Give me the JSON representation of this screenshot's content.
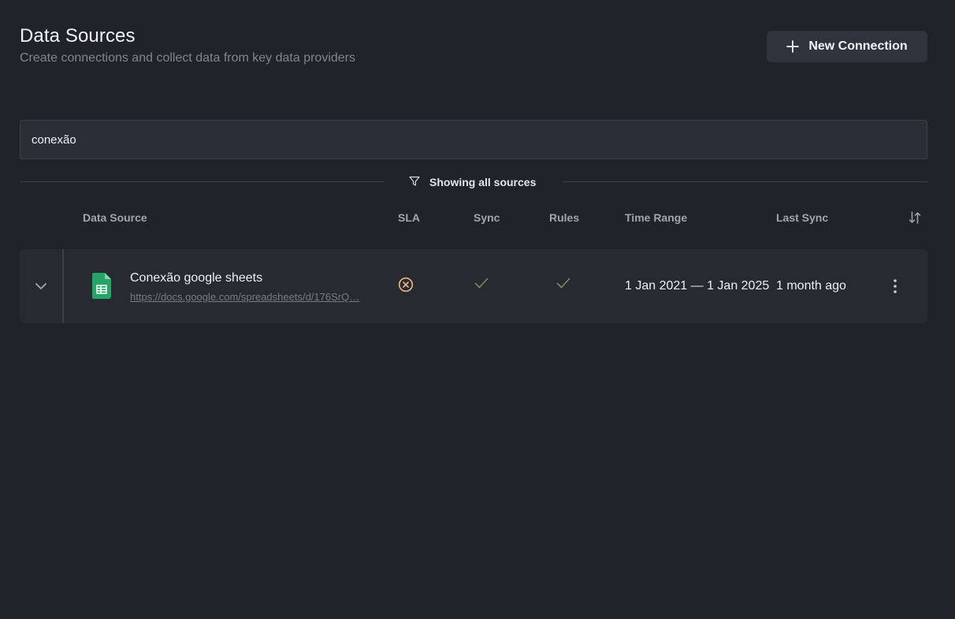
{
  "header": {
    "title": "Data Sources",
    "subtitle": "Create connections and collect data from key data providers",
    "new_connection_label": "New Connection",
    "new_connection_icon": "plus-icon"
  },
  "search": {
    "value": "conexão"
  },
  "filter": {
    "icon": "filter-icon",
    "label": "Showing all sources"
  },
  "table": {
    "columns": [
      "Data Source",
      "SLA",
      "Sync",
      "Rules",
      "Time Range",
      "Last Sync"
    ],
    "sort_icon": "sort-arrows-icon",
    "rows": [
      {
        "name": "Conexão google sheets",
        "link": "https://docs.google.com/spreadsheets/d/176SrQ…",
        "type_icon": "google-sheets-icon",
        "sla_status": "failed",
        "sla_icon": "x-circle-icon",
        "sync_status": "ok",
        "sync_icon": "check-icon",
        "rules_status": "ok",
        "rules_icon": "check-icon",
        "time_range": "1 Jan 2021 — 1 Jan 2025",
        "last_sync": "1 month ago"
      }
    ]
  },
  "colors": {
    "background": "#1f232a",
    "card": "#262a31",
    "sla_failed": "#e7b27c",
    "check_ok": "#7c8a60",
    "sheets_green": "#23a566"
  }
}
